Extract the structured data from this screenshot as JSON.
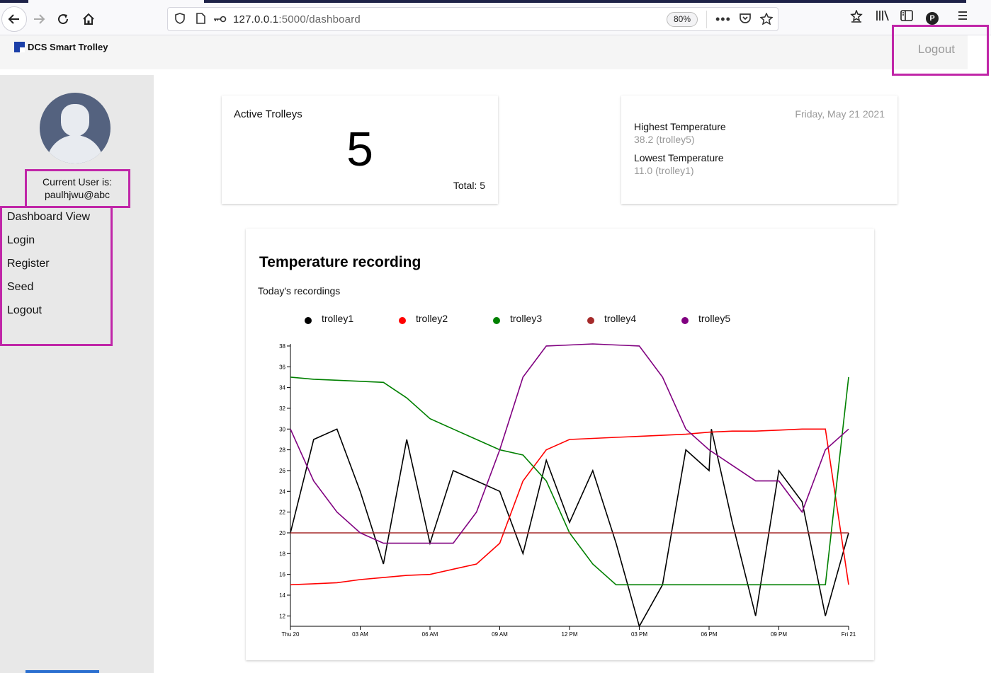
{
  "browser": {
    "url_host": "127.0.0.1",
    "url_path": ":5000/dashboard",
    "zoom": "80%",
    "profile_initial": "P"
  },
  "appbar": {
    "brand": "DCS Smart Trolley",
    "logout": "Logout"
  },
  "sidebar": {
    "current_user_label": "Current User is:",
    "current_user": "paulhjwu@abc",
    "menu": [
      "Dashboard View",
      "Login",
      "Register",
      "Seed",
      "Logout"
    ]
  },
  "active_trolleys": {
    "label": "Active Trolleys",
    "count": "5",
    "total": "Total: 5"
  },
  "temperature_summary": {
    "date": "Friday, May 21 2021",
    "highest_label": "Highest Temperature",
    "highest_value": "38.2 (trolley5)",
    "lowest_label": "Lowest Temperature",
    "lowest_value": "11.0 (trolley1)"
  },
  "chart": {
    "title": "Temperature recording",
    "subtitle": "Today's recordings"
  },
  "colors": {
    "highlight": "#c026a8",
    "trolley1": "#000000",
    "trolley2": "#ff0000",
    "trolley3": "#008000",
    "trolley4": "#a52a2a",
    "trolley5": "#800080"
  },
  "chart_data": {
    "type": "line",
    "title": "Temperature recording",
    "subtitle": "Today's recordings",
    "x_ticks": [
      "Thu 20",
      "03 AM",
      "06 AM",
      "09 AM",
      "12 PM",
      "03 PM",
      "06 PM",
      "09 PM",
      "Fri 21"
    ],
    "x_unit": "hours since Thu 20 00:00",
    "xlim": [
      0,
      24
    ],
    "ylim": [
      11,
      38.2
    ],
    "y_ticks": [
      12,
      14,
      16,
      18,
      20,
      22,
      24,
      26,
      28,
      30,
      32,
      34,
      36,
      38
    ],
    "grid": false,
    "legend": "top",
    "series": [
      {
        "name": "trolley1",
        "color": "#000000",
        "x": [
          0,
          1,
          2,
          3,
          4,
          5,
          6,
          7,
          8,
          9,
          10,
          11,
          12,
          13,
          14,
          15,
          16,
          17,
          18,
          18.1,
          19,
          20,
          21,
          22,
          23,
          24
        ],
        "y": [
          20,
          29,
          30,
          24,
          17,
          29,
          19,
          26,
          25,
          24,
          18,
          27,
          21,
          26,
          19,
          11,
          15,
          28,
          26,
          30,
          21,
          12,
          26,
          23,
          12,
          20
        ]
      },
      {
        "name": "trolley2",
        "color": "#ff0000",
        "x": [
          0,
          1,
          2,
          3,
          4,
          5,
          6,
          7,
          8,
          9,
          10,
          11,
          12,
          13,
          14,
          15,
          16,
          17,
          18,
          19,
          20,
          21,
          22,
          23,
          24
        ],
        "y": [
          15,
          15.1,
          15.2,
          15.5,
          15.7,
          15.9,
          16,
          16.5,
          17,
          19,
          25,
          28,
          29,
          29.1,
          29.2,
          29.3,
          29.4,
          29.5,
          29.7,
          29.8,
          29.8,
          29.9,
          30,
          30,
          15
        ]
      },
      {
        "name": "trolley3",
        "color": "#008000",
        "x": [
          0,
          1,
          2,
          3,
          4,
          5,
          6,
          7,
          8,
          9,
          10,
          11,
          12,
          13,
          14,
          15,
          16,
          17,
          18,
          19,
          20,
          21,
          22,
          23,
          24
        ],
        "y": [
          35,
          34.8,
          34.7,
          34.6,
          34.5,
          33,
          31,
          30,
          29,
          28,
          27.5,
          25,
          20,
          17,
          15,
          15,
          15,
          15,
          15,
          15,
          15,
          15,
          15,
          15,
          35
        ]
      },
      {
        "name": "trolley4",
        "color": "#a52a2a",
        "x": [
          0,
          24
        ],
        "y": [
          20,
          20
        ]
      },
      {
        "name": "trolley5",
        "color": "#800080",
        "x": [
          0,
          1,
          2,
          3,
          4,
          5,
          6,
          7,
          8,
          9,
          10,
          11,
          12,
          13,
          14,
          15,
          16,
          17,
          18,
          19,
          20,
          21,
          22,
          23,
          24
        ],
        "y": [
          30,
          25,
          22,
          20,
          19,
          19,
          19,
          19,
          22,
          28,
          35,
          38,
          38.1,
          38.2,
          38.1,
          38,
          35,
          30,
          28,
          26.5,
          25,
          25,
          22,
          28,
          30
        ]
      }
    ]
  }
}
